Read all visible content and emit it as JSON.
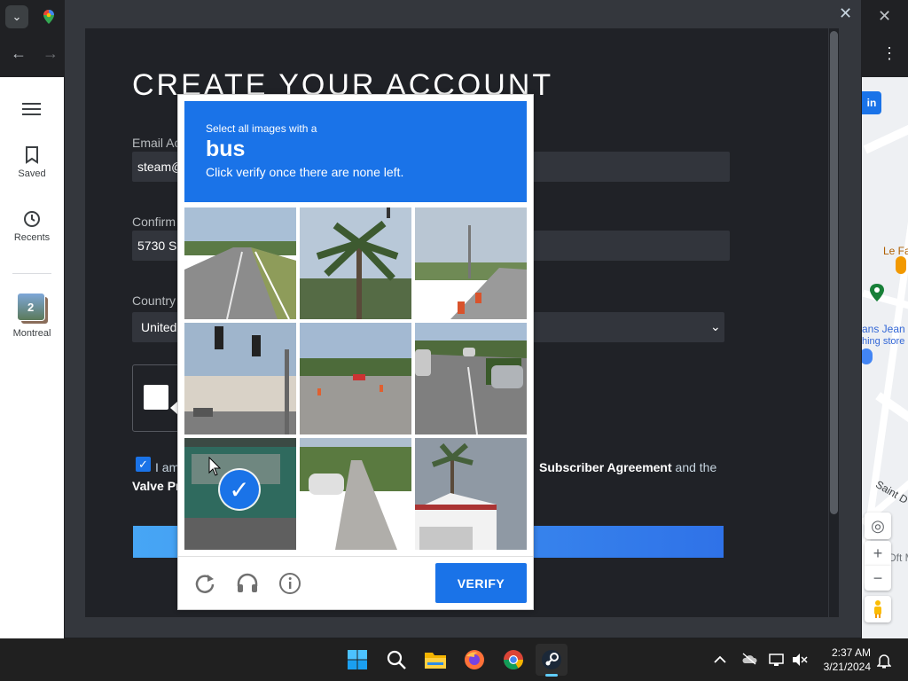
{
  "browser": {
    "tab_chevron_icon": "chevron-down-icon",
    "favicon_icon": "google-maps-icon",
    "close_glyph": "✕",
    "back_glyph": "←",
    "forward_glyph": "→",
    "menu_glyph": "⋮"
  },
  "maps_sidebar": {
    "items": [
      {
        "label": "Saved",
        "icon": "bookmark-icon"
      },
      {
        "label": "Recents",
        "icon": "history-icon"
      },
      {
        "label": "Montreal",
        "icon": "place-thumbnail",
        "badge": "2"
      }
    ]
  },
  "map": {
    "signin_label": "in",
    "labels": [
      "Le Fa",
      "ans Jean",
      "hing store",
      "Saint D",
      "Dft M"
    ],
    "controls": {
      "locate": "◎",
      "zoom_in": "+",
      "zoom_out": "−"
    }
  },
  "steam": {
    "title": "CREATE YOUR ACCOUNT",
    "close_glyph": "✕",
    "email_label": "Email Ac",
    "email_value": "steam@",
    "confirm_label": "Confirm",
    "confirm_value": "5730 S",
    "country_label": "Country",
    "country_value": "United",
    "agree_prefix": "I am",
    "agree_subscriber": "Subscriber Agreement",
    "agree_and_the": " and the",
    "agree_valve": "Valve Pr"
  },
  "captcha": {
    "instruction_line1": "Select all images with a",
    "target_word": "bus",
    "instruction_line3": "Click verify once there are none left.",
    "verify_label": "VERIFY",
    "footer_icons": [
      "reload-icon",
      "audio-headphones-icon",
      "info-icon"
    ],
    "tiles": [
      {
        "scene": "highway",
        "selected": false
      },
      {
        "scene": "palm-tree",
        "selected": false
      },
      {
        "scene": "road-construction",
        "selected": false
      },
      {
        "scene": "traffic-lights",
        "selected": false
      },
      {
        "scene": "parking-lot",
        "selected": false
      },
      {
        "scene": "cars-on-road",
        "selected": false
      },
      {
        "scene": "bus",
        "selected": true
      },
      {
        "scene": "street-car",
        "selected": false
      },
      {
        "scene": "house-palm",
        "selected": false
      }
    ],
    "accent": "#1a73e8"
  },
  "taskbar": {
    "apps": [
      "windows-start-icon",
      "search-icon",
      "file-explorer-icon",
      "firefox-icon",
      "chrome-icon",
      "steam-icon"
    ],
    "active_app": "steam-icon",
    "time": "2:37 AM",
    "date": "3/21/2024"
  }
}
